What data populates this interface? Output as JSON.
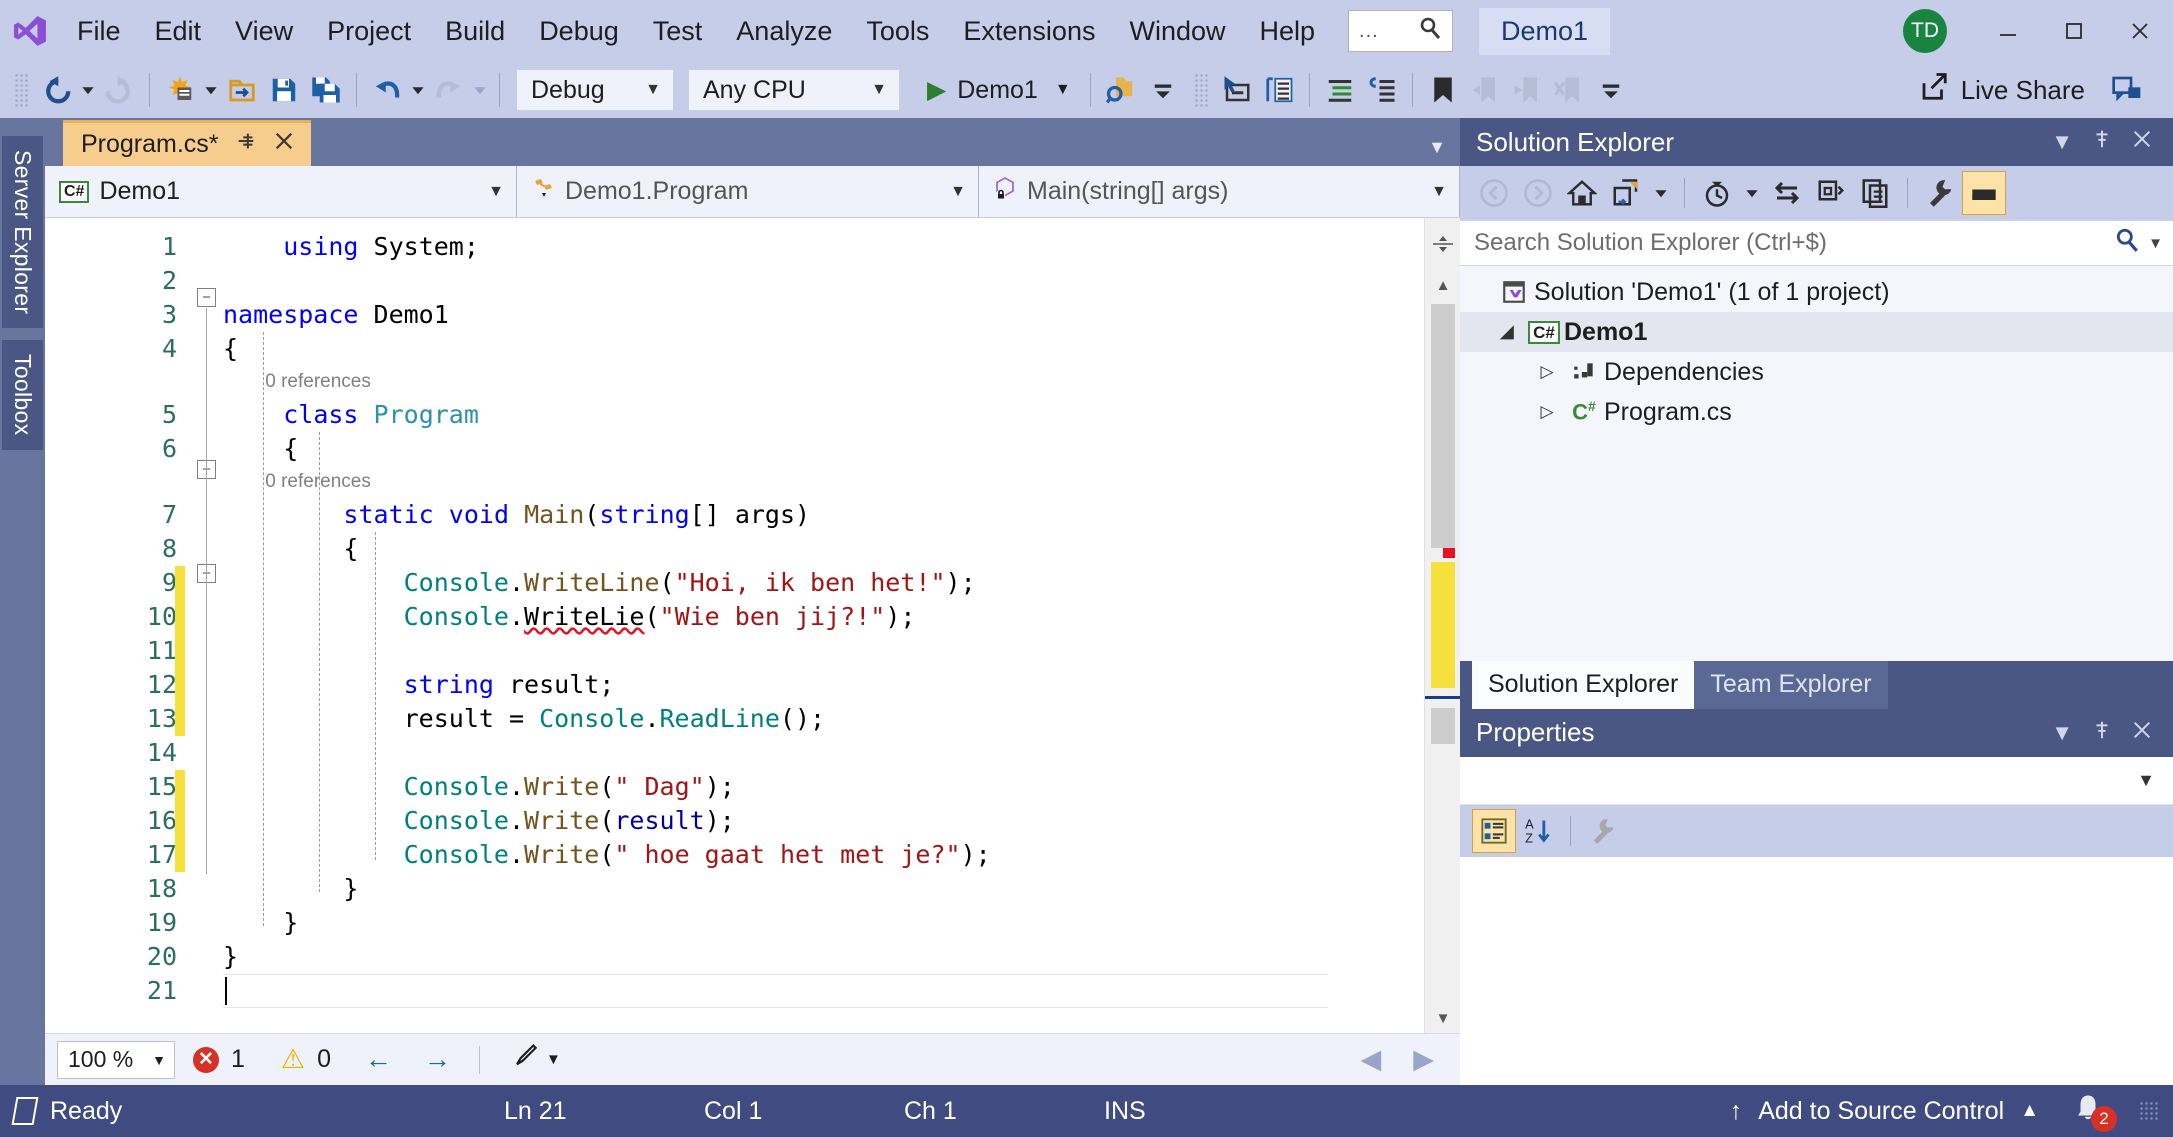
{
  "window": {
    "title": "Demo1",
    "avatar_initials": "TD",
    "minimize_icon": "minimize-icon",
    "maximize_icon": "maximize-icon",
    "close_icon": "close-icon"
  },
  "menu": {
    "items": [
      "File",
      "Edit",
      "View",
      "Project",
      "Build",
      "Debug",
      "Test",
      "Analyze",
      "Tools",
      "Extensions",
      "Window",
      "Help"
    ],
    "quick_launch_dots": "...",
    "quick_launch_icon": "search-icon"
  },
  "toolbar": {
    "back_icon": "navigate-back-icon",
    "forward_icon": "navigate-forward-icon",
    "new_project_icon": "new-project-icon",
    "open_icon": "open-file-icon",
    "save_icon": "save-icon",
    "save_all_icon": "save-all-icon",
    "undo_icon": "undo-icon",
    "redo_icon": "redo-icon",
    "configuration": "Debug",
    "platform": "Any CPU",
    "start_label": "Demo1",
    "start_icon": "play-icon",
    "find_in_files_icon": "search-folder-icon",
    "overflow_icon": "toolbar-overflow-icon",
    "select_icon": "pointer-box-icon",
    "indent_icon": "indent-icon",
    "comment_icon": "comment-icon",
    "uncomment_icon": "uncomment-icon",
    "bookmark_icon": "bookmark-icon",
    "prev_bookmark_icon": "previous-bookmark-icon",
    "next_bookmark_icon": "next-bookmark-icon",
    "clear_bookmarks_icon": "clear-bookmarks-icon",
    "live_share": "Live Share",
    "live_share_icon": "live-share-icon",
    "feedback_icon": "feedback-icon"
  },
  "leftrail": {
    "tabs": [
      "Server Explorer",
      "Toolbox"
    ]
  },
  "editor": {
    "tab_label": "Program.cs*",
    "tab_pin_icon": "pin-icon",
    "tab_close_icon": "close-icon",
    "tabstrip_dropdown_icon": "chevron-down-icon",
    "navbar": {
      "project": "Demo1",
      "project_badge": "C#",
      "type": "Demo1.Program",
      "type_icon": "class-icon",
      "member": "Main(string[] args)",
      "member_icon": "method-private-icon"
    },
    "lines": [
      {
        "n": "1",
        "segs": [
          {
            "t": "    ",
            "c": "k-plain"
          },
          {
            "t": "using",
            "c": "k-blue"
          },
          {
            "t": " System;",
            "c": "k-plain"
          }
        ]
      },
      {
        "n": "2",
        "segs": []
      },
      {
        "n": "3",
        "segs": [
          {
            "t": "namespace",
            "c": "k-blue"
          },
          {
            "t": " Demo1",
            "c": "k-plain"
          }
        ]
      },
      {
        "n": "4",
        "segs": [
          {
            "t": "{",
            "c": "k-plain"
          }
        ]
      },
      {
        "n": "5",
        "ref": "0 references",
        "segs": [
          {
            "t": "    ",
            "c": "k-plain"
          },
          {
            "t": "class",
            "c": "k-blue"
          },
          {
            "t": " ",
            "c": "k-plain"
          },
          {
            "t": "Program",
            "c": "k-teal"
          }
        ]
      },
      {
        "n": "6",
        "segs": [
          {
            "t": "    {",
            "c": "k-plain"
          }
        ]
      },
      {
        "n": "7",
        "ref": "0 references",
        "segs": [
          {
            "t": "        ",
            "c": "k-plain"
          },
          {
            "t": "static",
            "c": "k-blue"
          },
          {
            "t": " ",
            "c": "k-plain"
          },
          {
            "t": "void",
            "c": "k-blue"
          },
          {
            "t": " ",
            "c": "k-plain"
          },
          {
            "t": "Main",
            "c": "k-meth"
          },
          {
            "t": "(",
            "c": "k-plain"
          },
          {
            "t": "string",
            "c": "k-blue"
          },
          {
            "t": "[] ",
            "c": "k-plain"
          },
          {
            "t": "args",
            "c": "k-plain"
          }
        ]
      },
      {
        "n": "8",
        "segs": [
          {
            "t": "        {",
            "c": "k-plain"
          }
        ]
      },
      {
        "n": "9",
        "segs": [
          {
            "t": "            ",
            "c": "k-plain"
          },
          {
            "t": "Console",
            "c": "k-green"
          },
          {
            "t": ".",
            "c": "k-plain"
          },
          {
            "t": "WriteLine",
            "c": "k-meth"
          },
          {
            "t": "(",
            "c": "k-plain"
          },
          {
            "t": "\"Hoi, ik ben het!\"",
            "c": "k-str"
          },
          {
            "t": ");",
            "c": "k-plain"
          }
        ]
      },
      {
        "n": "10",
        "segs": [
          {
            "t": "            ",
            "c": "k-plain"
          },
          {
            "t": "Console",
            "c": "k-green"
          },
          {
            "t": ".",
            "c": "k-plain"
          },
          {
            "t": "WriteLie",
            "c": "k-plain squiggle"
          },
          {
            "t": "(",
            "c": "k-plain"
          },
          {
            "t": "\"Wie ben jij?!\"",
            "c": "k-str"
          },
          {
            "t": ");",
            "c": "k-plain"
          }
        ]
      },
      {
        "n": "11",
        "segs": []
      },
      {
        "n": "12",
        "segs": [
          {
            "t": "            ",
            "c": "k-plain"
          },
          {
            "t": "string",
            "c": "k-blue"
          },
          {
            "t": " result;",
            "c": "k-plain"
          }
        ]
      },
      {
        "n": "13",
        "segs": [
          {
            "t": "            result = ",
            "c": "k-plain"
          },
          {
            "t": "Console",
            "c": "k-green"
          },
          {
            "t": ".",
            "c": "k-plain"
          },
          {
            "t": "ReadLine",
            "c": "k-green"
          },
          {
            "t": "();",
            "c": "k-plain"
          }
        ]
      },
      {
        "n": "14",
        "segs": []
      },
      {
        "n": "15",
        "segs": [
          {
            "t": "            ",
            "c": "k-plain"
          },
          {
            "t": "Console",
            "c": "k-green"
          },
          {
            "t": ".",
            "c": "k-plain"
          },
          {
            "t": "Write",
            "c": "k-meth"
          },
          {
            "t": "(",
            "c": "k-plain"
          },
          {
            "t": "\" Dag\"",
            "c": "k-str"
          },
          {
            "t": ");",
            "c": "k-plain"
          }
        ]
      },
      {
        "n": "16",
        "segs": [
          {
            "t": "            ",
            "c": "k-plain"
          },
          {
            "t": "Console",
            "c": "k-green"
          },
          {
            "t": ".",
            "c": "k-plain"
          },
          {
            "t": "Write",
            "c": "k-meth"
          },
          {
            "t": "(",
            "c": "k-plain"
          },
          {
            "t": "result",
            "c": "k-darkblue"
          },
          {
            "t": ");",
            "c": "k-plain"
          }
        ]
      },
      {
        "n": "17",
        "segs": [
          {
            "t": "            ",
            "c": "k-plain"
          },
          {
            "t": "Console",
            "c": "k-green"
          },
          {
            "t": ".",
            "c": "k-plain"
          },
          {
            "t": "Write",
            "c": "k-meth"
          },
          {
            "t": "(",
            "c": "k-plain"
          },
          {
            "t": "\" hoe gaat het met je?\"",
            "c": "k-str"
          },
          {
            "t": ");",
            "c": "k-plain"
          }
        ]
      },
      {
        "n": "18",
        "segs": [
          {
            "t": "        }",
            "c": "k-plain"
          }
        ]
      },
      {
        "n": "19",
        "segs": [
          {
            "t": "    }",
            "c": "k-plain"
          }
        ]
      },
      {
        "n": "20",
        "segs": [
          {
            "t": "}",
            "c": "k-plain"
          }
        ]
      },
      {
        "n": "21",
        "segs": []
      }
    ],
    "bottom": {
      "zoom": "100 %",
      "zoom_caret_icon": "chevron-down-icon",
      "error_count": "1",
      "error_icon": "error-icon",
      "warning_count": "0",
      "warning_icon": "warning-icon",
      "prev_icon": "arrow-left-icon",
      "next_icon": "arrow-right-icon",
      "brush_icon": "formatting-brush-icon",
      "brush_caret_icon": "chevron-down-icon",
      "hscroll_left_icon": "scroll-left-icon",
      "hscroll_right_icon": "scroll-right-icon"
    }
  },
  "solution_explorer": {
    "title": "Solution Explorer",
    "dropdown_icon": "chevron-down-icon",
    "pin_icon": "pin-icon",
    "close_icon": "close-icon",
    "toolbar": {
      "back_icon": "back-icon",
      "forward_icon": "forward-icon",
      "home_icon": "home-icon",
      "pending_changes_icon": "pending-changes-icon",
      "pending_caret_icon": "chevron-down-icon",
      "history_icon": "history-icon",
      "history_caret_icon": "chevron-down-icon",
      "sync_icon": "sync-with-active-document-icon",
      "refresh_icon": "refresh-icon",
      "show_all_files_icon": "show-all-files-icon",
      "properties_icon": "properties-wrench-icon",
      "preview_icon": "preview-selected-items-icon"
    },
    "search_placeholder": "Search Solution Explorer (Ctrl+$)",
    "search_icon": "search-icon",
    "search_caret_icon": "chevron-down-icon",
    "tree": [
      {
        "label": "Solution 'Demo1' (1 of 1 project)",
        "icon": "solution-icon",
        "indent": 0,
        "twisty": "",
        "selected": false,
        "bold": false
      },
      {
        "label": "Demo1",
        "icon": "csharp-project-icon",
        "indent": 1,
        "twisty": "expanded",
        "selected": true,
        "bold": true
      },
      {
        "label": "Dependencies",
        "icon": "dependencies-icon",
        "indent": 2,
        "twisty": "collapsed",
        "selected": false,
        "bold": false
      },
      {
        "label": "Program.cs",
        "icon": "csharp-file-icon",
        "indent": 2,
        "twisty": "collapsed",
        "selected": false,
        "bold": false
      }
    ],
    "tabs": [
      {
        "label": "Solution Explorer",
        "active": true
      },
      {
        "label": "Team Explorer",
        "active": false
      }
    ]
  },
  "properties": {
    "title": "Properties",
    "dropdown_icon": "chevron-down-icon",
    "pin_icon": "pin-icon",
    "close_icon": "close-icon",
    "object_caret_icon": "chevron-down-icon",
    "categorized_icon": "categorized-view-icon",
    "alphabetical_icon": "alphabetical-sort-icon",
    "property_pages_icon": "property-pages-wrench-icon"
  },
  "statusbar": {
    "status_icon": "ready-icon",
    "status": "Ready",
    "line": "Ln 21",
    "column": "Col 1",
    "character": "Ch 1",
    "insert_mode": "INS",
    "source_control": "Add to Source Control",
    "source_control_icon": "upload-arrow-icon",
    "source_control_caret_icon": "chevron-up-icon",
    "notification_icon": "bell-icon",
    "notification_count": "2"
  },
  "colors": {
    "chrome": "#c5cde9",
    "panel_header": "#4a5784",
    "status_bar": "#3f4b81",
    "tab_active": "#f7cd8e",
    "accent_blue": "#2b4a8b",
    "error_red": "#d93025",
    "warning_yellow": "#e8b500",
    "change_bar": "#f5e03c",
    "avatar_green": "#17853f"
  }
}
